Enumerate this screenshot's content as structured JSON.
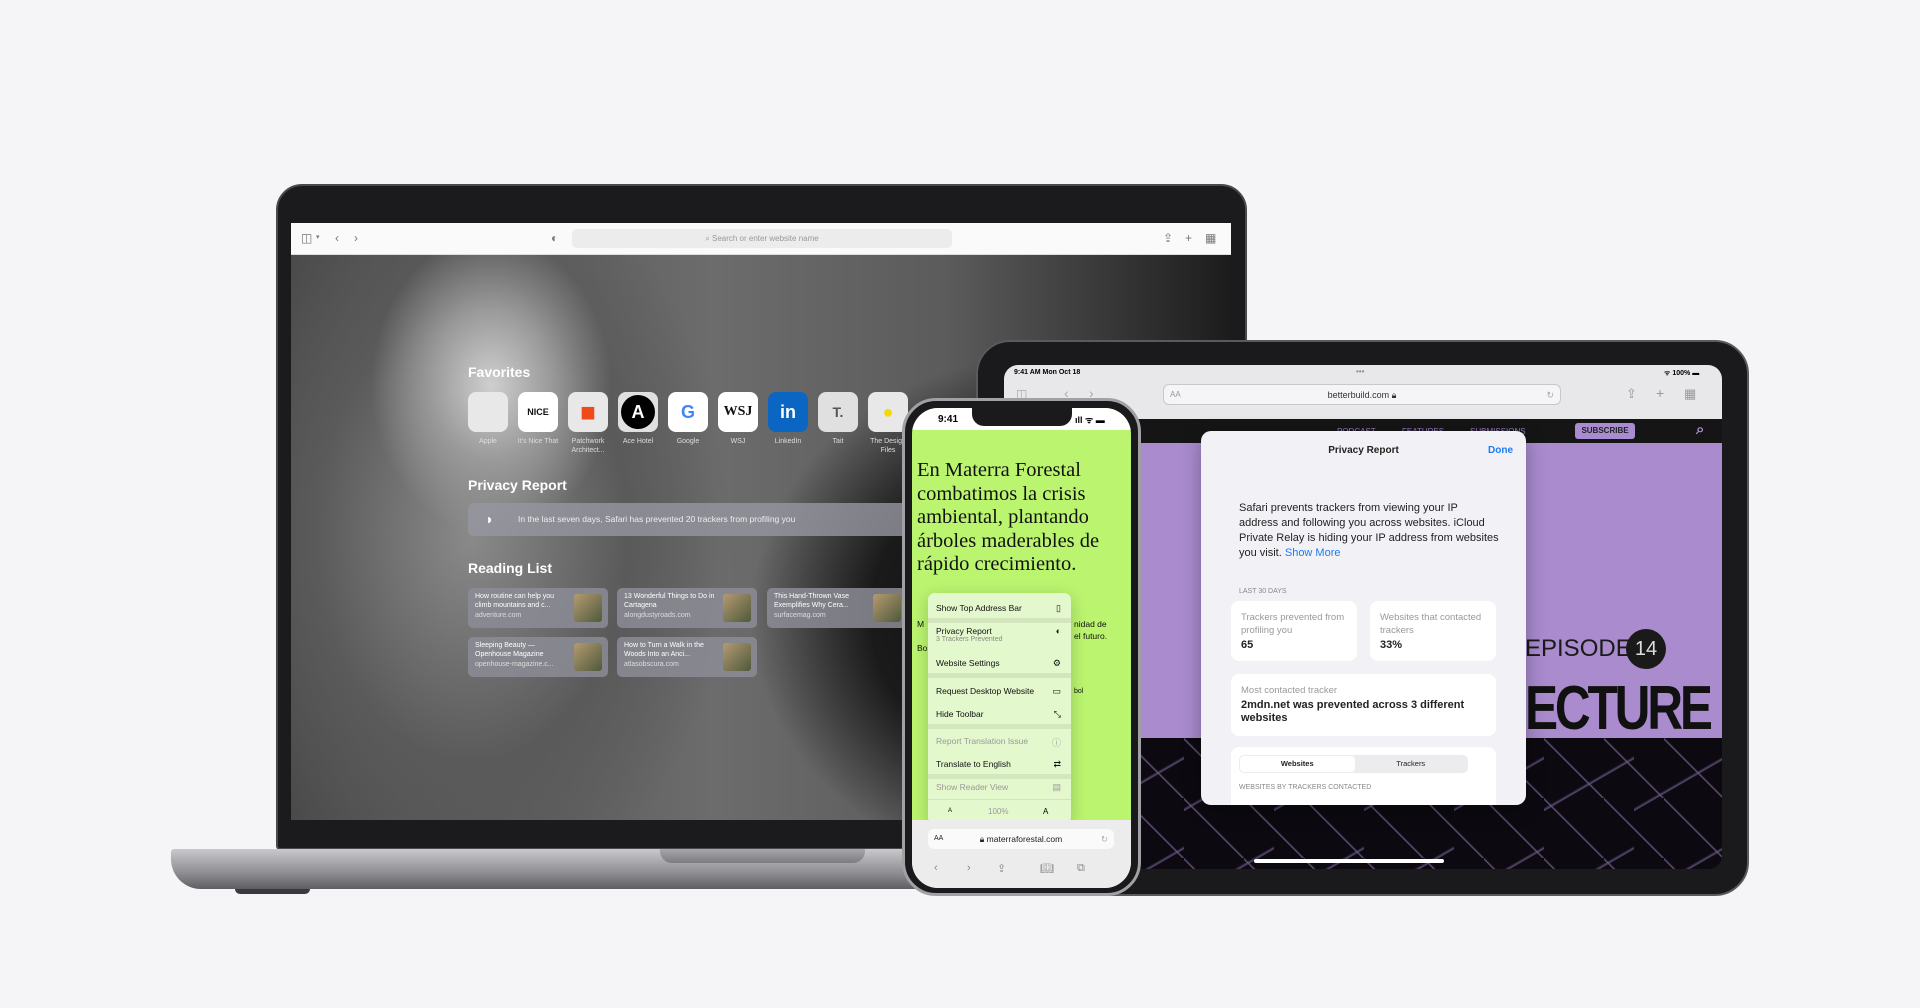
{
  "mac": {
    "toolbar": {
      "search_placeholder": "Search or enter website name",
      "sidebar_icon": "sidebar-icon",
      "back_icon": "chevron-left-icon",
      "forward_icon": "chevron-right-icon",
      "privacy_icon": "shield-icon",
      "share_icon": "share-icon",
      "new_tab_icon": "plus-icon",
      "tabs_icon": "tab-overview-icon"
    },
    "favorites_title": "Favorites",
    "favorites": [
      {
        "label": "Apple",
        "glyph": ""
      },
      {
        "label": "It's Nice That",
        "glyph": "NICE"
      },
      {
        "label": "Patchwork Architect...",
        "glyph": "■"
      },
      {
        "label": "Ace Hotel",
        "glyph": "A"
      },
      {
        "label": "Google",
        "glyph": "G"
      },
      {
        "label": "WSJ",
        "glyph": "WSJ"
      },
      {
        "label": "LinkedIn",
        "glyph": "in"
      },
      {
        "label": "Tait",
        "glyph": "T."
      },
      {
        "label": "The Design Files",
        "glyph": "●"
      }
    ],
    "privacy_title": "Privacy Report",
    "privacy_text": "In the last seven days, Safari has prevented 20 trackers from profiling you",
    "reading_title": "Reading List",
    "reading": [
      {
        "title": "How routine can help you climb mountains and c...",
        "domain": "adventure.com"
      },
      {
        "title": "13 Wonderful Things to Do in Cartagena",
        "domain": "alongdustyroads.com"
      },
      {
        "title": "This Hand-Thrown Vase Exemplifies Why Cera...",
        "domain": "surfacemag.com"
      },
      {
        "title": "Sleeping Beauty — Openhouse Magazine",
        "domain": "openhouse-magazine.c..."
      },
      {
        "title": "How to Turn a Walk in the Woods Into an Anci...",
        "domain": "atlasobscura.com"
      }
    ]
  },
  "ipad": {
    "status_time": "9:41 AM  Mon Oct 18",
    "battery": "100%",
    "url": "betterbuild.com",
    "text_size": "AA",
    "nav": [
      "PODCAST",
      "FEATURES",
      "SUBMISSIONS"
    ],
    "subscribe": "SUBSCRIBE",
    "episode": "EPISODE",
    "episode_num": "14",
    "headline": "ECTURE",
    "sheet": {
      "title": "Privacy Report",
      "done": "Done",
      "desc": "Safari prevents trackers from viewing your IP address and following you across websites. iCloud Private Relay is hiding your IP address from websites you visit.",
      "show_more": "Show More",
      "period": "LAST 30 DAYS",
      "stat1_label": "Trackers prevented from profiling you",
      "stat1_value": "65",
      "stat2_label": "Websites that contacted trackers",
      "stat2_value": "33%",
      "most_label": "Most contacted tracker",
      "most_value": "2mdn.net was prevented across 3 different websites",
      "seg": [
        "Websites",
        "Trackers"
      ],
      "list_caption": "WEBSITES BY TRACKERS CONTACTED"
    },
    "accent": "#1a7cf5",
    "purple": "#a98bce"
  },
  "iphone": {
    "time": "9:41",
    "headline": "En Materra Forestal combatimos la crisis ambiental, plantando árboles maderables de rápido crecimiento.",
    "body_frag1": "M",
    "body_frag2": "nidad de",
    "body_frag3": "el futuro.",
    "body_frag4": "Bo",
    "body_frag5": "bol",
    "menu": [
      {
        "label": "Show Top Address Bar",
        "icon": "▯"
      },
      {
        "label": "Privacy Report",
        "sub": "3 Trackers Prevented",
        "icon": "◐"
      },
      {
        "label": "Website Settings",
        "icon": "⚙"
      },
      {
        "label": "Request Desktop Website",
        "icon": "▭"
      },
      {
        "label": "Hide Toolbar",
        "icon": "⤡"
      },
      {
        "label": "Report Translation Issue",
        "icon": "ⓘ"
      },
      {
        "label": "Translate to English",
        "icon": "⇄"
      },
      {
        "label": "Show Reader View",
        "icon": "▤"
      }
    ],
    "zoom_small": "A",
    "zoom_level": "100%",
    "zoom_large": "A",
    "url": "materraforestal.com",
    "text_size": "AA",
    "bg": "#bbf46f"
  }
}
